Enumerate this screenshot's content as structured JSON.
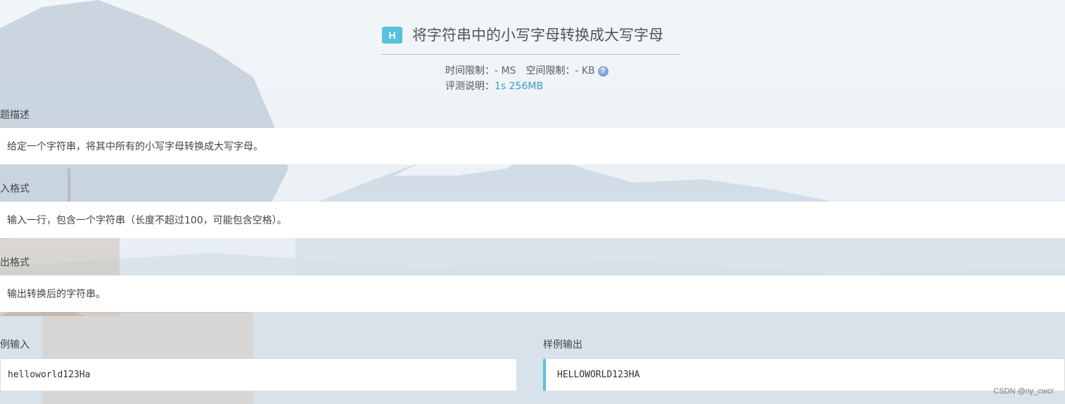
{
  "problem": {
    "badge": "H",
    "title": "将字符串中的小写字母转换成大写字母",
    "time_limit_label": "时间限制：",
    "time_limit_value": "- MS",
    "space_limit_label": "空间限制：",
    "space_limit_value": "- KB",
    "judge_label": "评测说明：",
    "judge_value": "1s 256MB"
  },
  "sections": {
    "description": {
      "label": "问题描述",
      "text": "给定一个字符串，将其中所有的小写字母转换成大写字母。"
    },
    "input_format": {
      "label": "输入格式",
      "text": "输入一行，包含一个字符串（长度不超过100，可能包含空格）。"
    },
    "output_format": {
      "label": "输出格式",
      "text": "输出转换后的字符串。"
    }
  },
  "samples": {
    "input_label": "样例输入",
    "input_value": "helloworld123Ha",
    "output_label": "样例输出",
    "output_value": "HELLOWORLD123HA"
  },
  "watermark": "CSDN @ny_cwcr",
  "colors": {
    "accent": "#5bc0de",
    "link_blue": "#31a0c4"
  }
}
